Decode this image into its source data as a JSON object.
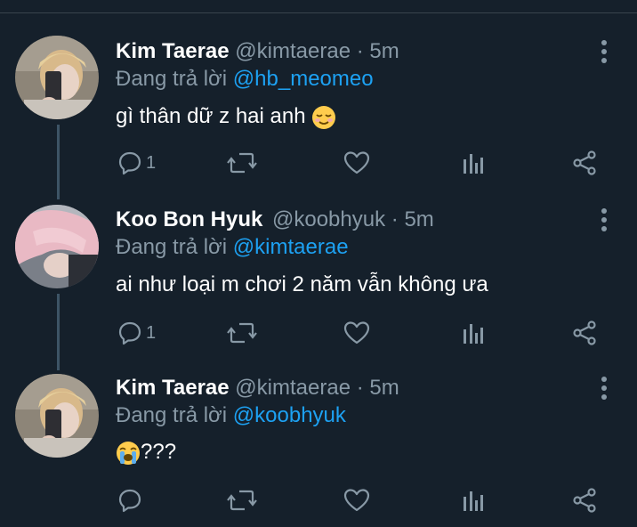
{
  "tweets": [
    {
      "name": "Kim Taerae",
      "handle": "@kimtaerae",
      "dot": "·",
      "time": "5m",
      "replying_prefix": "Đang trả lời",
      "replying_to": "@hb_meomeo",
      "text": "gì thân dữ z hai anh",
      "emoji": "relieved-face-emoji",
      "reply_count": "1",
      "avatar": "avatar-mirror-selfie"
    },
    {
      "name": "Koo Bon Hyuk",
      "handle": "@koobhyuk",
      "dot": "·",
      "time": "5m",
      "replying_prefix": "Đang trả lời",
      "replying_to": "@kimtaerae",
      "text": "ai như loại m chơi 2 năm vẫn không ưa",
      "reply_count": "1",
      "avatar": "avatar-pink-hair"
    },
    {
      "name": "Kim Taerae",
      "handle": "@kimtaerae",
      "dot": "·",
      "time": "5m",
      "replying_prefix": "Đang trả lời",
      "replying_to": "@koobhyuk",
      "text": "???",
      "emoji": "crying-face-emoji",
      "reply_count": "",
      "avatar": "avatar-mirror-selfie"
    }
  ],
  "icons": {
    "reply": "reply-icon",
    "retweet": "retweet-icon",
    "like": "heart-icon",
    "stats": "stats-icon",
    "share": "share-icon",
    "more": "more-icon"
  },
  "colors": {
    "background": "#15202b",
    "secondary_text": "#8899a6",
    "mention": "#1da1f2",
    "thread_line": "#3d5466"
  }
}
